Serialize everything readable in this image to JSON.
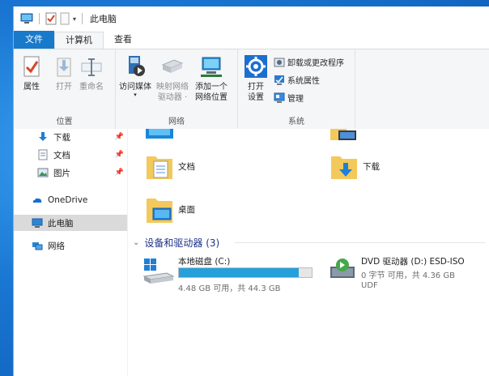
{
  "window": {
    "title": "此电脑"
  },
  "tabs": [
    "文件",
    "计算机",
    "查看"
  ],
  "ribbon": {
    "location": {
      "label": "位置",
      "properties": "属性",
      "open": "打开",
      "rename": "重命名"
    },
    "network": {
      "label": "网络",
      "access_media": "访问媒体",
      "map_drive_1": "映射网络",
      "map_drive_2": "驱动器 ·",
      "add_location_1": "添加一个",
      "add_location_2": "网络位置"
    },
    "system": {
      "label": "系统",
      "open_settings_1": "打开",
      "open_settings_2": "设置",
      "uninstall": "卸载或更改程序",
      "sys_props": "系统属性",
      "manage": "管理"
    }
  },
  "nav": {
    "items": [
      {
        "label": "下载",
        "pinned": true
      },
      {
        "label": "文档",
        "pinned": true
      },
      {
        "label": "图片",
        "pinned": true
      },
      {
        "label": "OneDrive",
        "pinned": false
      },
      {
        "label": "此电脑",
        "pinned": false
      },
      {
        "label": "网络",
        "pinned": false
      }
    ],
    "pin_glyph": "📌"
  },
  "folders": [
    {
      "label": "文档"
    },
    {
      "label": "下载"
    },
    {
      "label": "桌面"
    }
  ],
  "devices": {
    "heading": "设备和驱动器 (3)",
    "drives": [
      {
        "name": "本地磁盘 (C:)",
        "detail": "4.48 GB 可用，共 44.3 GB",
        "used_fraction": 0.9
      },
      {
        "name": "DVD 驱动器 (D:) ESD-ISO",
        "detail": "0 字节 可用，共 4.36 GB",
        "fs": "UDF"
      }
    ]
  },
  "colors": {
    "accent": "#1979ca",
    "bar_fill": "#26a0da",
    "heading": "#1e3287"
  }
}
